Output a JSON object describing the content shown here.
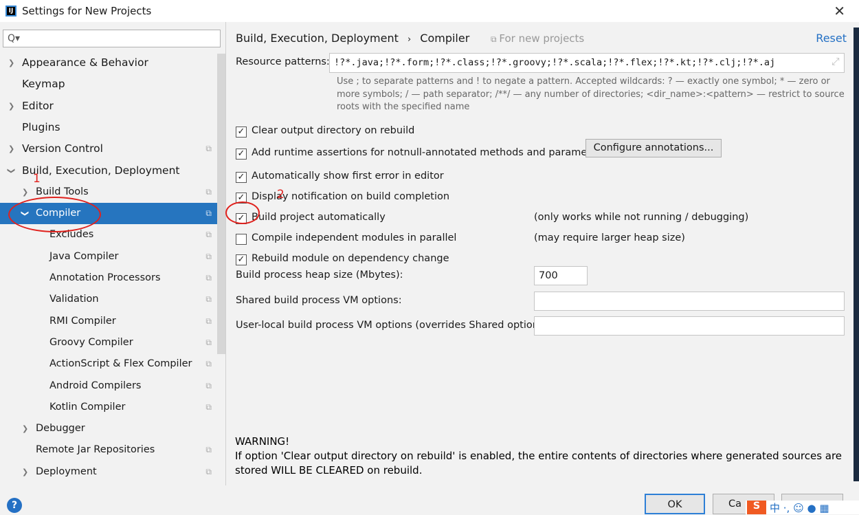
{
  "window": {
    "title": "Settings for New Projects",
    "close_icon": "close-icon"
  },
  "sidebar": {
    "search_placeholder": "Q▾",
    "items": [
      {
        "label": "Appearance & Behavior",
        "level": 0,
        "arrow": "›",
        "copy": false
      },
      {
        "label": "Keymap",
        "level": 0,
        "arrow": "",
        "copy": false
      },
      {
        "label": "Editor",
        "level": 0,
        "arrow": "›",
        "copy": false
      },
      {
        "label": "Plugins",
        "level": 0,
        "arrow": "",
        "copy": false
      },
      {
        "label": "Version Control",
        "level": 0,
        "arrow": "›",
        "copy": true
      },
      {
        "label": "Build, Execution, Deployment",
        "level": 0,
        "arrow": "⌄",
        "copy": false
      },
      {
        "label": "Build Tools",
        "level": 1,
        "arrow": "›",
        "copy": true
      },
      {
        "label": "Compiler",
        "level": 1,
        "arrow": "⌄",
        "copy": true,
        "selected": true
      },
      {
        "label": "Excludes",
        "level": 2,
        "arrow": "",
        "copy": true
      },
      {
        "label": "Java Compiler",
        "level": 2,
        "arrow": "",
        "copy": true
      },
      {
        "label": "Annotation Processors",
        "level": 2,
        "arrow": "",
        "copy": true
      },
      {
        "label": "Validation",
        "level": 2,
        "arrow": "",
        "copy": true
      },
      {
        "label": "RMI Compiler",
        "level": 2,
        "arrow": "",
        "copy": true
      },
      {
        "label": "Groovy Compiler",
        "level": 2,
        "arrow": "",
        "copy": true
      },
      {
        "label": "ActionScript & Flex Compiler",
        "level": 2,
        "arrow": "",
        "copy": true
      },
      {
        "label": "Android Compilers",
        "level": 2,
        "arrow": "",
        "copy": true
      },
      {
        "label": "Kotlin Compiler",
        "level": 2,
        "arrow": "",
        "copy": true
      },
      {
        "label": "Debugger",
        "level": 1,
        "arrow": "›",
        "copy": false
      },
      {
        "label": "Remote Jar Repositories",
        "level": 1,
        "arrow": "",
        "copy": true
      },
      {
        "label": "Deployment",
        "level": 1,
        "arrow": "›",
        "copy": true
      }
    ]
  },
  "main": {
    "breadcrumb": [
      "Build, Execution, Deployment",
      "Compiler"
    ],
    "breadcrumb_sep": "›",
    "for_new_projects": "For new projects",
    "reset": "Reset",
    "resource_label": "Resource patterns:",
    "resource_value": "!?*.java;!?*.form;!?*.class;!?*.groovy;!?*.scala;!?*.flex;!?*.kt;!?*.clj;!?*.aj",
    "hint": "Use ; to separate patterns and ! to negate a pattern. Accepted wildcards: ? — exactly one symbol; * — zero or more symbols; / — path separator; /**/ — any number of directories; <dir_name>:<pattern> — restrict to source roots with the specified name",
    "options": [
      {
        "label": "Clear output directory on rebuild",
        "checked": true,
        "note": ""
      },
      {
        "label": "Add runtime assertions for notnull-annotated methods and parameters",
        "checked": true,
        "note": ""
      },
      {
        "label": "Automatically show first error in editor",
        "checked": true,
        "note": ""
      },
      {
        "label": "Display notification on build completion",
        "checked": true,
        "note": ""
      },
      {
        "label": "Build project automatically",
        "checked": true,
        "note": "(only works while not running / debugging)"
      },
      {
        "label": "Compile independent modules in parallel",
        "checked": false,
        "note": "(may require larger heap size)"
      },
      {
        "label": "Rebuild module on dependency change",
        "checked": true,
        "note": ""
      }
    ],
    "configure_annotations": "Configure annotations...",
    "heap_label": "Build process heap size (Mbytes):",
    "heap_value": "700",
    "shared_vm_label": "Shared build process VM options:",
    "shared_vm_value": "",
    "user_vm_label": "User-local build process VM options (overrides Shared options):",
    "user_vm_value": "",
    "warning_title": "WARNING!",
    "warning_text": "If option 'Clear output directory on rebuild' is enabled, the entire contents of directories where generated sources are stored WILL BE CLEARED on rebuild."
  },
  "footer": {
    "help": "?",
    "ok": "OK",
    "cancel": "Ca"
  },
  "annotations": {
    "one": "1",
    "two": "2",
    "color": "#e0221e"
  },
  "colors": {
    "selection": "#2675bf",
    "link": "#2470c4"
  }
}
